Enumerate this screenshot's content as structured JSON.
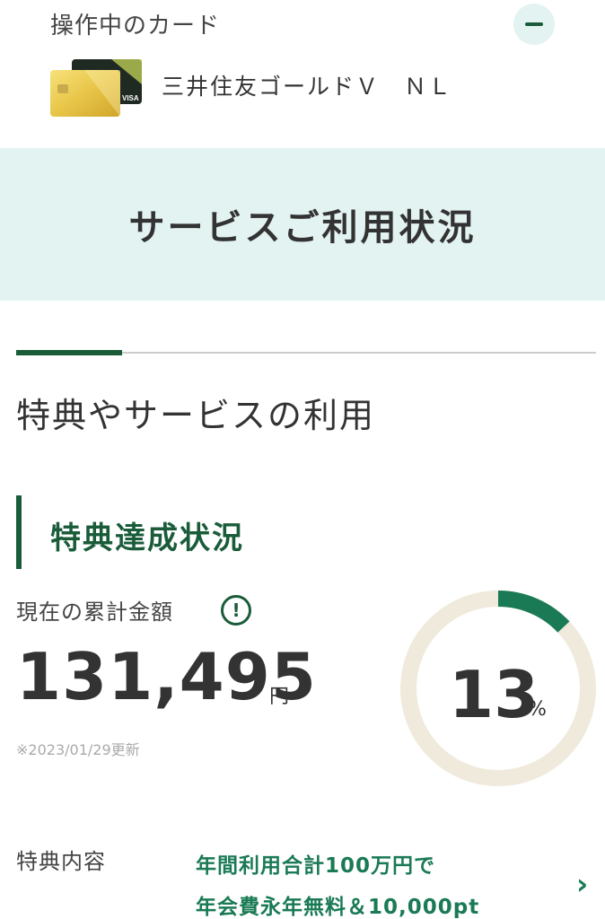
{
  "card": {
    "header_label": "操作中のカード",
    "card_name": "三井住友ゴールドＶ　ＮＬ",
    "card_logo_text": "VISA"
  },
  "banner": {
    "title": "サービスご利用状況"
  },
  "section": {
    "title": "特典やサービスの利用"
  },
  "benefit_status": {
    "heading": "特典達成状況",
    "total_label": "現在の累計金額",
    "info_icon": "!",
    "amount": "131,495",
    "amount_unit": "円",
    "update_note": "※2023/01/29更新",
    "progress_value": "13",
    "progress_unit": "%",
    "progress_fraction": 0.13
  },
  "benefit_detail": {
    "label": "特典内容",
    "line1": "年間利用合計100万円で",
    "line2": "年会費永年無料＆10,000pt",
    "chevron": "›"
  },
  "colors": {
    "accent": "#1a5c3a",
    "accent_text": "#1a7a55",
    "banner_bg": "#e3f3f1",
    "gauge_track": "#efeadb",
    "gauge_fill": "#1a7a55"
  }
}
